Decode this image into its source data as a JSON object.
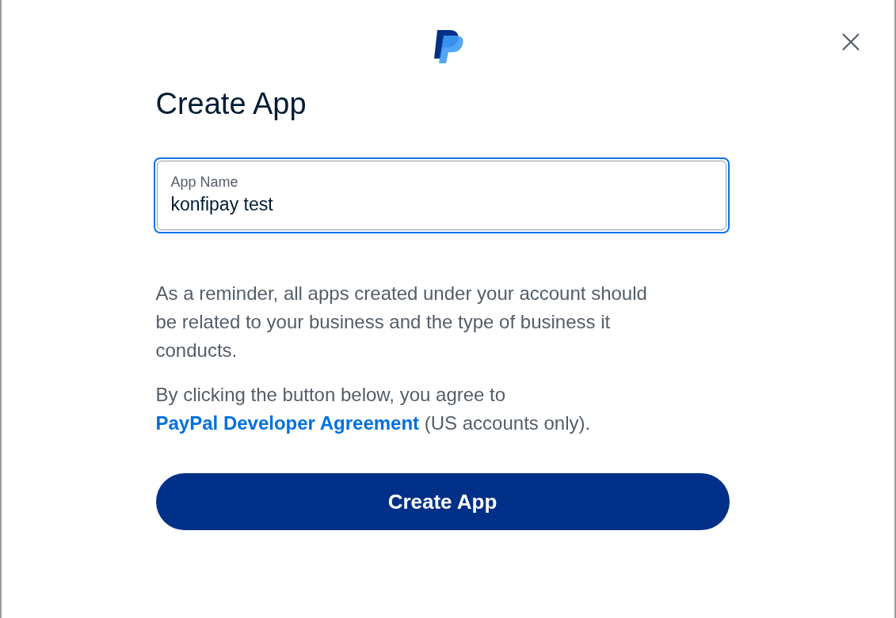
{
  "dialog": {
    "title": "Create App",
    "field": {
      "label": "App Name",
      "value": "konfipay test",
      "focused": true
    },
    "reminder": "As a reminder, all apps created under your account should be related to your business and the type of business it conducts.",
    "agreement": {
      "before": "By clicking the button below, you agree to",
      "link": "PayPal Developer Agreement",
      "after": "(US accounts only)."
    },
    "button": "Create App"
  }
}
